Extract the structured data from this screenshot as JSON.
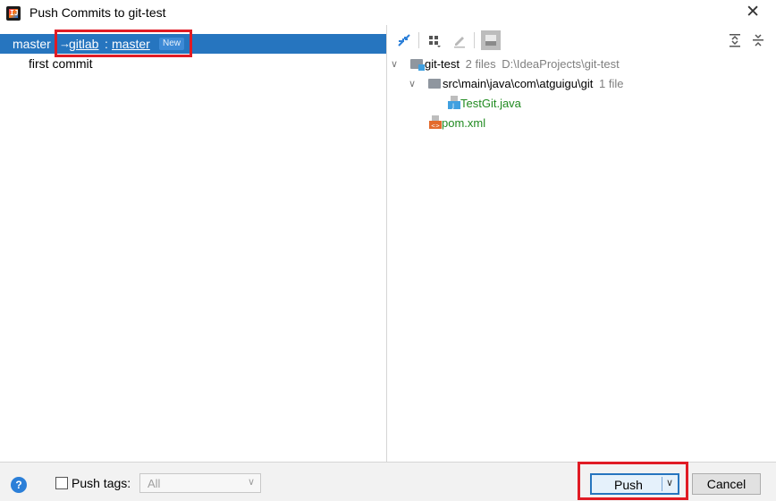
{
  "window": {
    "title": "Push Commits to git-test",
    "close_glyph": "✕"
  },
  "left": {
    "local_branch": "master",
    "arrow": "→",
    "remote": "gitlab",
    "colon": ":",
    "remote_branch": "master",
    "badge": "New",
    "commits": [
      "first commit"
    ]
  },
  "tree": {
    "root_name": "git-test",
    "root_count": "2 files",
    "root_path": "D:\\IdeaProjects\\git-test",
    "folder_path": "src\\main\\java\\com\\atguigu\\git",
    "folder_count": "1 file",
    "file1": "TestGit.java",
    "file2": "pom.xml"
  },
  "bottom": {
    "help_glyph": "?",
    "push_tags_label": "Push tags:",
    "tags_value": "All",
    "push_label": "Push",
    "cancel_label": "Cancel"
  },
  "colors": {
    "selection": "#2675bf",
    "highlight_box": "#e01b24",
    "modified_file": "#218b21"
  }
}
